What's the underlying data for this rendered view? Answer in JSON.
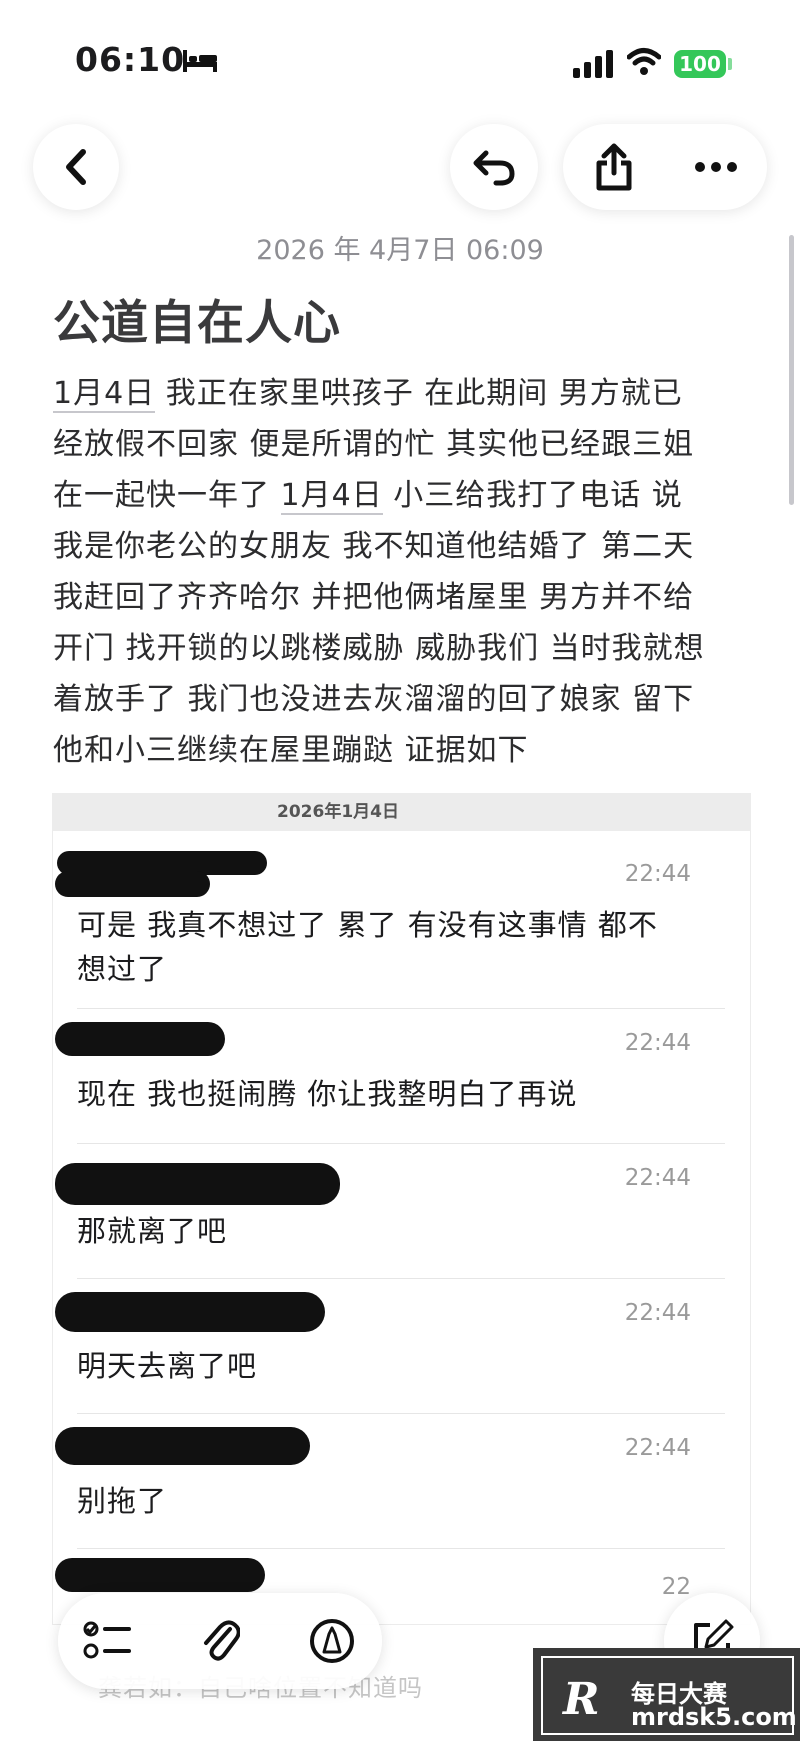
{
  "status_bar": {
    "time": "06:10",
    "battery": "100"
  },
  "note": {
    "date": "2026 年 4月7日 06:09",
    "title": "公道自在人心",
    "lines": [
      [
        "1月4日",
        " 我正在家里哄孩子 在此期间 男方就已"
      ],
      [
        "",
        "经放假不回家 便是所谓的忙 其实他已经跟三姐"
      ],
      [
        "",
        "在一起快一年了 ",
        "1月4日",
        " 小三给我打了电话 说"
      ],
      [
        "",
        "我是你老公的女朋友 我不知道他结婚了 第二天"
      ],
      [
        "",
        "我赶回了齐齐哈尔 并把他俩堵屋里 男方并不给"
      ],
      [
        "",
        "开门 找开锁的以跳楼威胁 威胁我们 当时我就想"
      ],
      [
        "",
        "着放手了 我门也没进去灰溜溜的回了娘家 留下"
      ],
      [
        "",
        "他和小三继续在屋里蹦跶 证据如下"
      ]
    ]
  },
  "embedded_chat": {
    "date_header": "2026年1月4日",
    "messages": [
      {
        "time": "22:44",
        "text": "可是 我真不想过了 累了 有没有这事情 都不想过了"
      },
      {
        "time": "22:44",
        "text": "现在 我也挺闹腾 你让我整明白了再说"
      },
      {
        "time": "22:44",
        "text": "那就离了吧"
      },
      {
        "time": "22:44",
        "text": "明天去离了吧"
      },
      {
        "time": "22:44",
        "text": "别拖了"
      },
      {
        "time": "22",
        "text": ""
      }
    ],
    "faded_text": "龚若如：自己啥位置不知道吗"
  },
  "watermark": {
    "logo": "R",
    "name": "每日大赛",
    "url": "mrdsk5.com"
  },
  "icons": [
    "back-icon",
    "undo-icon",
    "share-icon",
    "more-icon",
    "checklist-icon",
    "attachment-icon",
    "markup-icon",
    "compose-icon"
  ]
}
